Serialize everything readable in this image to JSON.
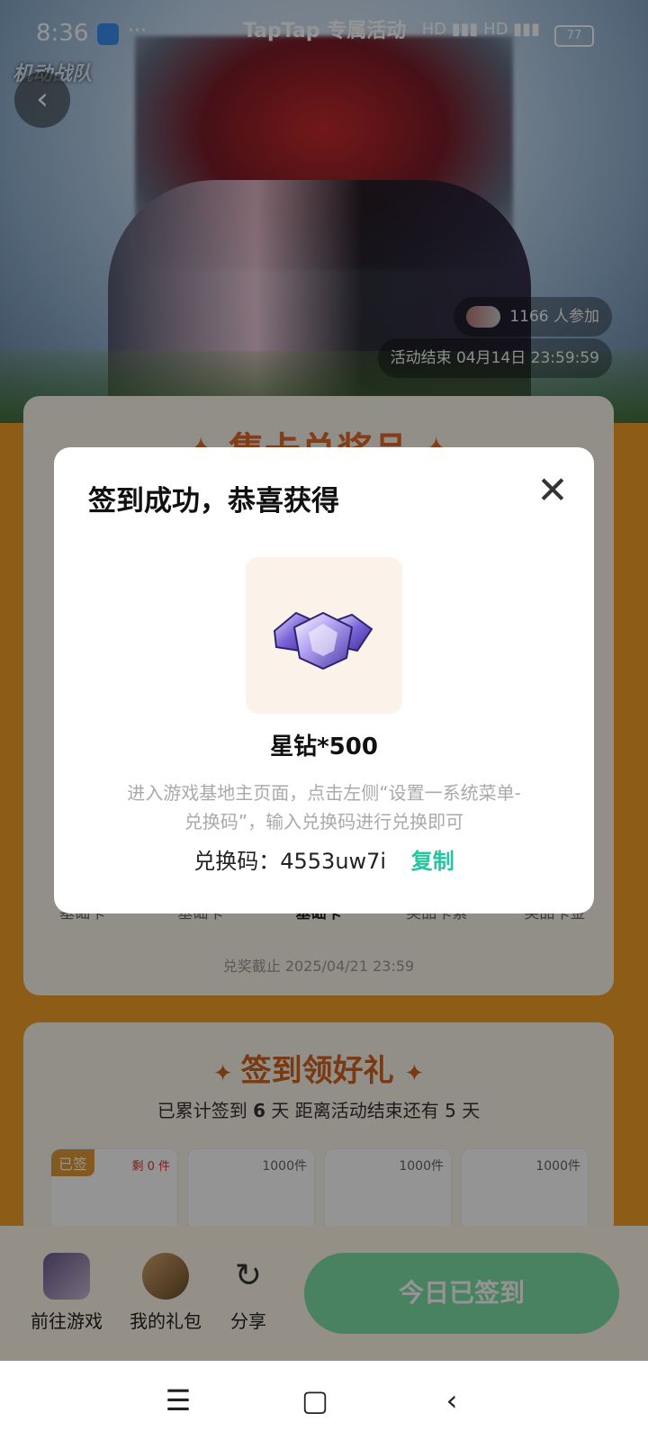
{
  "status": {
    "time": "8:36",
    "dots": "···",
    "header_brand": "TapTap 专属活动",
    "network": "HD ▮▮▮ HD ▮▮▮",
    "battery": "77"
  },
  "hero": {
    "logo_text": "机动战队",
    "participants": "1166 人参加",
    "end_time": "活动结束 04月14日 23:59:59"
  },
  "card1": {
    "title": "✦ 集卡总奖品 ✦",
    "tabs": [
      "基础卡",
      "基础卡",
      "基础卡",
      "奖品卡紫",
      "奖品卡金"
    ],
    "deadline": "兑奖截止 2025/04/21 23:59"
  },
  "card2": {
    "title": "签到领好礼",
    "sub_prefix": "已累计签到",
    "days": "6",
    "sub_mid": "天  距离活动结束还有",
    "remaining": "5",
    "sub_suffix": "天",
    "rewards": [
      {
        "badge": "已签",
        "left": "剩 0 件"
      },
      {
        "count": "1000件"
      },
      {
        "count": "1000件"
      },
      {
        "count": "1000件"
      }
    ]
  },
  "bottom_bar": {
    "game_label": "前往游戏",
    "gift_label": "我的礼包",
    "share_label": "分享",
    "signed_label": "今日已签到"
  },
  "modal": {
    "title": "签到成功，恭喜获得",
    "reward_name": "星钻*500",
    "desc_line1": "进入游戏基地主页面，点击左侧“设置一系统菜单-",
    "desc_line2": "兑换码”，输入兑换码进行兑换即可",
    "code_label": "兑换码：4553uw7i",
    "copy_label": "复制"
  }
}
